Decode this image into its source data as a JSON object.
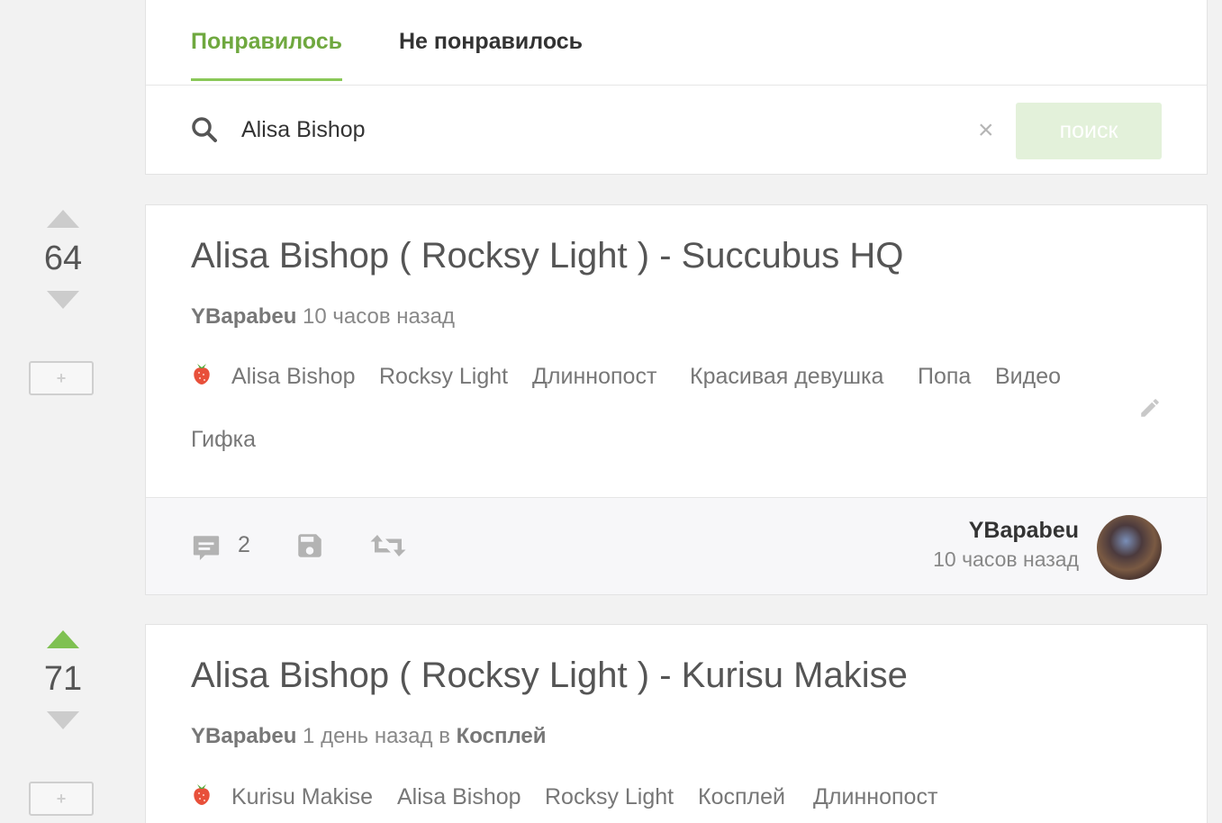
{
  "tabs": {
    "liked": "Понравилось",
    "disliked": "Не понравилось"
  },
  "search": {
    "value": "Alisa Bishop",
    "button_label": "поиск",
    "clear_icon": "close-icon",
    "search_icon": "search-icon"
  },
  "colors": {
    "accent": "#6fa83f",
    "vote_active": "#7fc152",
    "vote_inactive": "#cccccc"
  },
  "posts": [
    {
      "rating": "64",
      "title": "Alisa Bishop ( Rocksy Light ) - Succubus HQ",
      "author": "YBapabeu",
      "time": "10 часов назад",
      "tags": [
        "Alisa Bishop",
        "Rocksy Light",
        "Длиннопост",
        "Красивая девушка",
        "Попа",
        "Видео",
        "Гифка"
      ],
      "comments": "2",
      "footer_author": "YBapabeu",
      "footer_time": "10 часов назад",
      "add_label": "+"
    },
    {
      "rating": "71",
      "title": "Alisa Bishop ( Rocksy Light ) - Kurisu Makise",
      "author": "YBapabeu",
      "time": "1 день назад в",
      "community": "Косплей",
      "tags": [
        "Kurisu Makise",
        "Alisa Bishop",
        "Rocksy Light",
        "Косплей",
        "Длиннопост"
      ],
      "add_label": "+"
    }
  ]
}
